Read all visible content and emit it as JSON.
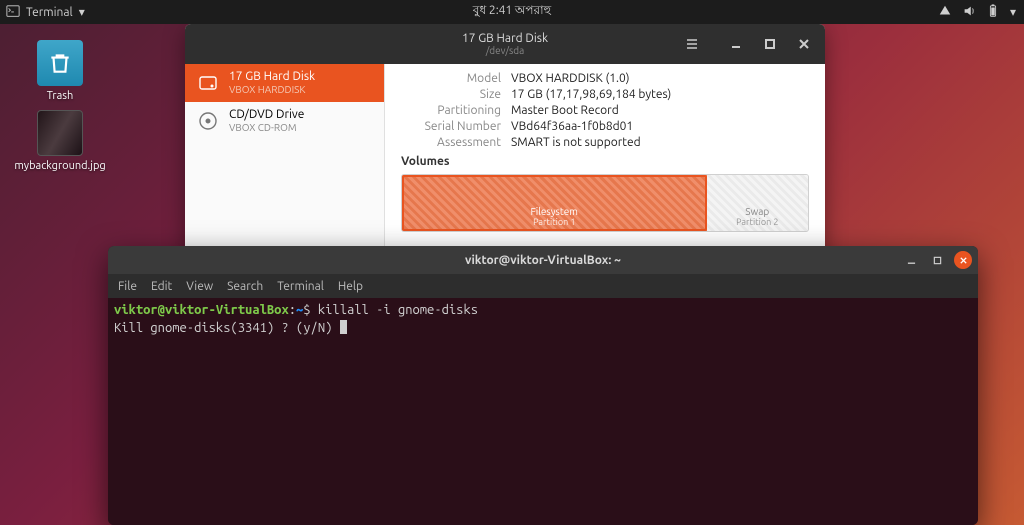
{
  "panel": {
    "app_label": "Terminal",
    "clock": "বুধ 2:41 অপরাহু"
  },
  "desktop": {
    "trash_label": "Trash",
    "wallpaper_label": "mybackground.jpg"
  },
  "disks": {
    "title": "17 GB Hard Disk",
    "subtitle": "/dev/sda",
    "sidebar": [
      {
        "primary": "17 GB Hard Disk",
        "secondary": "VBOX HARDDISK",
        "active": true,
        "icon": "hdd"
      },
      {
        "primary": "CD/DVD Drive",
        "secondary": "VBOX CD-ROM",
        "active": false,
        "icon": "cd"
      }
    ],
    "details": [
      {
        "k": "Model",
        "v": "VBOX HARDDISK (1.0)"
      },
      {
        "k": "Size",
        "v": "17 GB (17,17,98,69,184 bytes)"
      },
      {
        "k": "Partitioning",
        "v": "Master Boot Record"
      },
      {
        "k": "Serial Number",
        "v": "VBd64f36aa-1f0b8d01"
      },
      {
        "k": "Assessment",
        "v": "SMART is not supported"
      }
    ],
    "volumes_header": "Volumes",
    "volumes": [
      {
        "label1": "Filesystem",
        "label2": "Partition 1"
      },
      {
        "label1": "Swap",
        "label2": "Partition 2"
      }
    ]
  },
  "terminal": {
    "title": "viktor@viktor-VirtualBox: ~",
    "menu": [
      "File",
      "Edit",
      "View",
      "Search",
      "Terminal",
      "Help"
    ],
    "ps1_user": "viktor@viktor-VirtualBox",
    "ps1_colon": ":",
    "ps1_path": "~",
    "ps1_dollar": "$ ",
    "command": "killall -i gnome-disks",
    "line2": "Kill gnome-disks(3341) ? (y/N) "
  }
}
